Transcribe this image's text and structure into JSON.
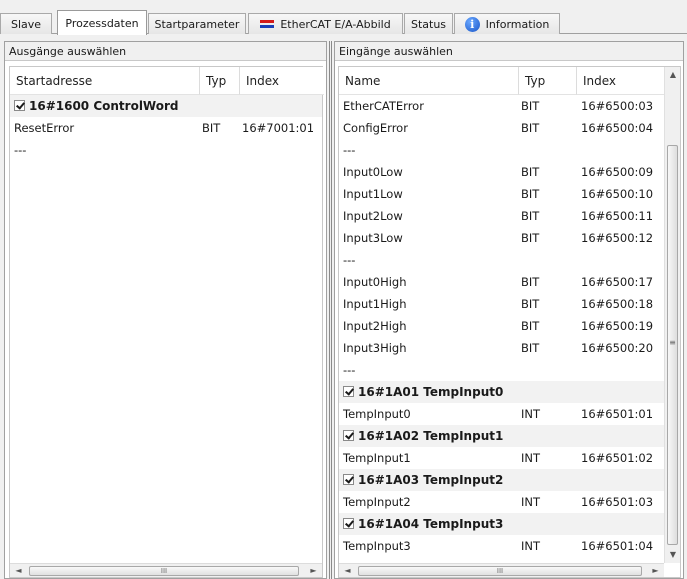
{
  "tabs": [
    {
      "label": "Slave",
      "active": false
    },
    {
      "label": "Prozessdaten",
      "active": true
    },
    {
      "label": "Startparameter",
      "active": false
    },
    {
      "label": "EtherCAT E/A-Abbild",
      "active": false,
      "icon": "ethercat-icon"
    },
    {
      "label": "Status",
      "active": false
    },
    {
      "label": "Information",
      "active": false,
      "icon": "info-icon"
    }
  ],
  "outputs": {
    "title": "Ausgänge auswählen",
    "columns": [
      "Startadresse",
      "Typ",
      "Index"
    ],
    "rows": [
      {
        "group": true,
        "checked": true,
        "name": "16#1600 ControlWord",
        "type": "",
        "index": ""
      },
      {
        "group": false,
        "name": "ResetError",
        "type": "BIT",
        "index": "16#7001:01"
      },
      {
        "group": false,
        "name": "---",
        "type": "",
        "index": ""
      }
    ]
  },
  "inputs": {
    "title": "Eingänge auswählen",
    "columns": [
      "Name",
      "Typ",
      "Index"
    ],
    "rows": [
      {
        "group": false,
        "name": "EtherCATError",
        "type": "BIT",
        "index": "16#6500:03"
      },
      {
        "group": false,
        "name": "ConfigError",
        "type": "BIT",
        "index": "16#6500:04"
      },
      {
        "group": false,
        "name": "---",
        "type": "",
        "index": ""
      },
      {
        "group": false,
        "name": "Input0Low",
        "type": "BIT",
        "index": "16#6500:09"
      },
      {
        "group": false,
        "name": "Input1Low",
        "type": "BIT",
        "index": "16#6500:10"
      },
      {
        "group": false,
        "name": "Input2Low",
        "type": "BIT",
        "index": "16#6500:11"
      },
      {
        "group": false,
        "name": "Input3Low",
        "type": "BIT",
        "index": "16#6500:12"
      },
      {
        "group": false,
        "name": "---",
        "type": "",
        "index": ""
      },
      {
        "group": false,
        "name": "Input0High",
        "type": "BIT",
        "index": "16#6500:17"
      },
      {
        "group": false,
        "name": "Input1High",
        "type": "BIT",
        "index": "16#6500:18"
      },
      {
        "group": false,
        "name": "Input2High",
        "type": "BIT",
        "index": "16#6500:19"
      },
      {
        "group": false,
        "name": "Input3High",
        "type": "BIT",
        "index": "16#6500:20"
      },
      {
        "group": false,
        "name": "---",
        "type": "",
        "index": ""
      },
      {
        "group": true,
        "checked": true,
        "name": "16#1A01 TempInput0",
        "type": "",
        "index": ""
      },
      {
        "group": false,
        "name": "TempInput0",
        "type": "INT",
        "index": "16#6501:01"
      },
      {
        "group": true,
        "checked": true,
        "name": "16#1A02 TempInput1",
        "type": "",
        "index": ""
      },
      {
        "group": false,
        "name": "TempInput1",
        "type": "INT",
        "index": "16#6501:02"
      },
      {
        "group": true,
        "checked": true,
        "name": "16#1A03 TempInput2",
        "type": "",
        "index": ""
      },
      {
        "group": false,
        "name": "TempInput2",
        "type": "INT",
        "index": "16#6501:03"
      },
      {
        "group": true,
        "checked": true,
        "name": "16#1A04 TempInput3",
        "type": "",
        "index": ""
      },
      {
        "group": false,
        "name": "TempInput3",
        "type": "INT",
        "index": "16#6501:04"
      }
    ]
  },
  "scroll": {
    "left_glyph": "◄",
    "right_glyph": "►",
    "up_glyph": "▲",
    "down_glyph": "▼",
    "grip": "III",
    "vgrip": "≡"
  }
}
